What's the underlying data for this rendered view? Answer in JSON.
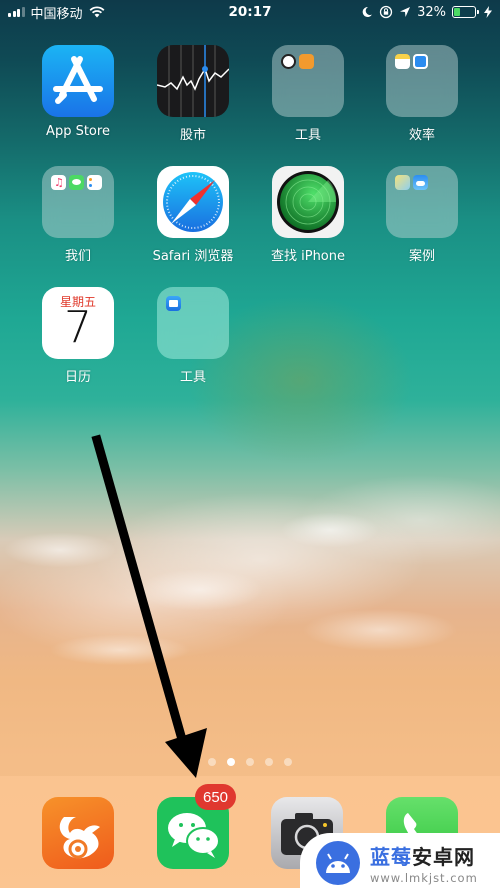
{
  "status_bar": {
    "carrier": "中国移动",
    "time": "20:17",
    "battery_percent_label": "32%",
    "battery_level": 0.32,
    "signal_bars_active": 3,
    "signal_bars_total": 5,
    "icons": [
      "signal-icon",
      "wifi-icon",
      "do-not-disturb-moon-icon",
      "rotation-lock-icon",
      "location-arrow-icon",
      "battery-icon",
      "charging-bolt-icon"
    ]
  },
  "apps": [
    {
      "label": "App Store",
      "type": "app",
      "icon": "app-store-icon"
    },
    {
      "label": "股市",
      "type": "app",
      "icon": "stocks-icon"
    },
    {
      "label": "工具",
      "type": "folder",
      "contents": [
        "clock-icon",
        "books-icon"
      ]
    },
    {
      "label": "效率",
      "type": "folder",
      "contents": [
        "notes-icon",
        "files-icon"
      ]
    },
    {
      "label": "我们",
      "type": "folder",
      "contents": [
        "music-icon",
        "messages-icon",
        "reminders-icon"
      ]
    },
    {
      "label": "Safari 浏览器",
      "type": "app",
      "icon": "safari-icon"
    },
    {
      "label": "查找 iPhone",
      "type": "app",
      "icon": "find-iphone-icon"
    },
    {
      "label": "案例",
      "type": "folder",
      "contents": [
        "maps-icon",
        "weather-icon"
      ]
    },
    {
      "label": "日历",
      "type": "app",
      "icon": "calendar-icon",
      "weekday": "星期五",
      "day": "7"
    },
    {
      "label": "工具",
      "type": "folder",
      "contents": [
        "mail-icon"
      ]
    }
  ],
  "page_dots": {
    "count": 5,
    "active_index": 1
  },
  "dock": [
    {
      "name": "UC浏览器",
      "icon": "uc-browser-icon"
    },
    {
      "name": "微信",
      "icon": "wechat-icon",
      "badge": "650"
    },
    {
      "name": "相机",
      "icon": "camera-icon"
    },
    {
      "name": "电话",
      "icon": "phone-icon"
    }
  ],
  "watermark": {
    "title_blue": "蓝莓",
    "title_dark": "安卓网",
    "url": "www.lmkjst.com"
  },
  "colors": {
    "badge": "#e0382f",
    "battery_fill": "#4cd964",
    "watermark_blue": "#3a6fe0",
    "calendar_red": "#e0392b"
  }
}
